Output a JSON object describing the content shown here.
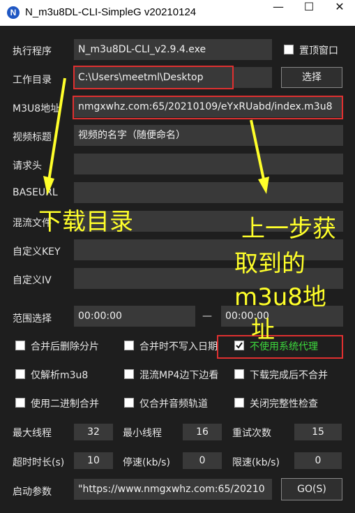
{
  "window": {
    "app_icon_letter": "N",
    "title": "N_m3u8DL-CLI-SimpleG v20210124",
    "minimize_glyph": "—",
    "maximize_glyph": "☐",
    "close_glyph": "✕"
  },
  "form": {
    "exe_label": "执行程序",
    "exe_value": "N_m3u8DL-CLI_v2.9.4.exe",
    "topmost_label": "置顶窗口",
    "workdir_label": "工作目录",
    "workdir_value": "C:\\Users\\meetml\\Desktop",
    "choose_button": "选择",
    "m3u8_label": "M3U8地址",
    "m3u8_value": "nmgxwhz.com:65/20210109/eYxRUabd/index.m3u8",
    "title_label": "视频标题",
    "title_value": "视频的名字（随便命名）",
    "header_label": "请求头",
    "header_value": "",
    "baseurl_label": "BASEURL",
    "baseurl_value": "",
    "mux_label": "混流文件",
    "mux_value": "",
    "key_label": "自定义KEY",
    "key_value": "",
    "iv_label": "自定义IV",
    "iv_value": "",
    "range_label": "范围选择",
    "range_start": "00:00:00",
    "range_sep": "—",
    "range_end": "00:00:00"
  },
  "options": {
    "merge_delete": "合并后删除分片",
    "no_log": "合并时不写入日期",
    "no_proxy": "不使用系统代理",
    "parse_only": "仅解析m3u8",
    "mux_mp4": "混流MP4边下边看",
    "no_merge": "下载完成后不合并",
    "binary_merge": "使用二进制合并",
    "audio_only": "仅合并音频轨道",
    "no_check": "关闭完整性检查"
  },
  "numbers": {
    "max_threads_label": "最大线程",
    "max_threads": "32",
    "min_threads_label": "最小线程",
    "min_threads": "16",
    "retry_label": "重试次数",
    "retry": "15",
    "timeout_label": "超时时长(s)",
    "timeout": "10",
    "stop_speed_label": "停速(kb/s)",
    "stop_speed": "0",
    "limit_speed_label": "限速(kb/s)",
    "limit_speed": "0"
  },
  "launch": {
    "label": "启动参数",
    "value": "\"https://www.nmgxwhz.com:65/20210",
    "go_button": "GO(S)"
  },
  "annotations": {
    "download_dir": "下载目录",
    "step_line1": "上一步获",
    "step_line2": "取到的",
    "step_line3": "m3u8地",
    "step_line4": "址"
  },
  "colors": {
    "annotation": "#ffff2a",
    "highlight_border": "#e03030",
    "proxy_text": "#3ddc3d"
  }
}
